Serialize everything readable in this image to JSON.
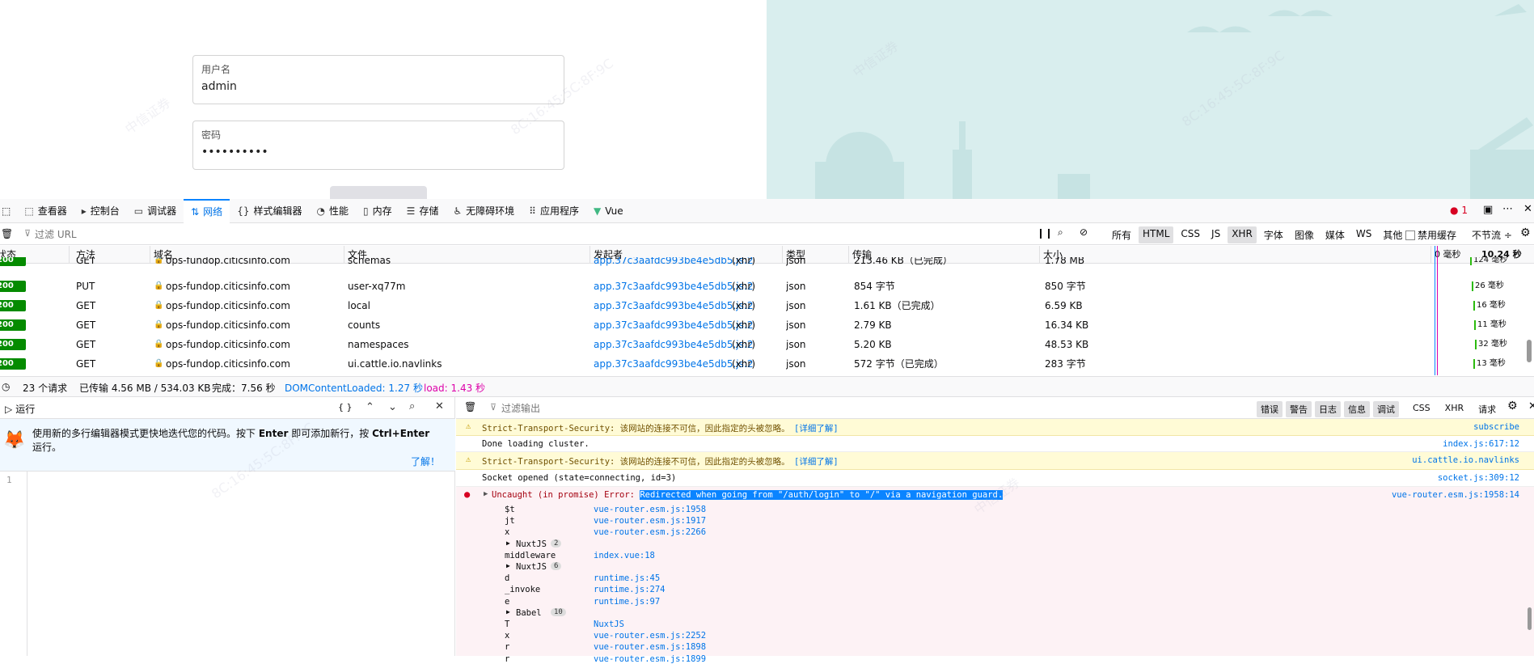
{
  "login": {
    "username_label": "用户名",
    "username_value": "admin",
    "password_label": "密码",
    "password_value": "••••••••••"
  },
  "devtools": {
    "tabs": [
      {
        "icon": "inspector-icon",
        "glyph": "⬚",
        "label": "查看器"
      },
      {
        "icon": "console-icon",
        "glyph": "▸",
        "label": "控制台"
      },
      {
        "icon": "debugger-icon",
        "glyph": "▭",
        "label": "调试器"
      },
      {
        "icon": "network-icon",
        "glyph": "⇅",
        "label": "网络"
      },
      {
        "icon": "style-editor-icon",
        "glyph": "{}",
        "label": "样式编辑器"
      },
      {
        "icon": "performance-icon",
        "glyph": "◔",
        "label": "性能"
      },
      {
        "icon": "memory-icon",
        "glyph": "▯",
        "label": "内存"
      },
      {
        "icon": "storage-icon",
        "glyph": "☰",
        "label": "存储"
      },
      {
        "icon": "accessibility-icon",
        "glyph": "♿",
        "label": "无障碍环境"
      },
      {
        "icon": "application-icon",
        "glyph": "⠿",
        "label": "应用程序"
      },
      {
        "icon": "vue-icon",
        "glyph": "▼",
        "label": "Vue"
      }
    ],
    "error_count": "1",
    "filter_placeholder": "过滤 URL",
    "filter_types": [
      "所有",
      "HTML",
      "CSS",
      "JS",
      "XHR",
      "字体",
      "图像",
      "媒体",
      "WS",
      "其他"
    ],
    "disable_cache_label": "禁用缓存",
    "throttle_label": "不节流 ÷",
    "columns": {
      "status": "状态",
      "method": "方法",
      "domain": "域名",
      "file": "文件",
      "initiator": "发起者",
      "type": "类型",
      "transferred": "传输",
      "size": "大小",
      "wf_zero": "0 毫秒",
      "wf_end": "10.24 秒"
    },
    "requests": [
      {
        "status": "200",
        "method": "GET",
        "domain": "ops-fundop.citicsinfo.com",
        "file": "schemas",
        "initiator": "app.37c3aafdc993be4e5db5.js:2",
        "initiator_type": "(xhr)",
        "type": "json",
        "transferred": "213.46 KB（已完成）",
        "size": "1.78 MB",
        "time": "124 毫秒"
      },
      {
        "status": "200",
        "method": "PUT",
        "domain": "ops-fundop.citicsinfo.com",
        "file": "user-xq77m",
        "initiator": "app.37c3aafdc993be4e5db5.js:2",
        "initiator_type": "(xhr)",
        "type": "json",
        "transferred": "854 字节",
        "size": "850 字节",
        "time": "26 毫秒"
      },
      {
        "status": "200",
        "method": "GET",
        "domain": "ops-fundop.citicsinfo.com",
        "file": "local",
        "initiator": "app.37c3aafdc993be4e5db5.js:2",
        "initiator_type": "(xhr)",
        "type": "json",
        "transferred": "1.61 KB（已完成）",
        "size": "6.59 KB",
        "time": "16 毫秒"
      },
      {
        "status": "200",
        "method": "GET",
        "domain": "ops-fundop.citicsinfo.com",
        "file": "counts",
        "initiator": "app.37c3aafdc993be4e5db5.js:2",
        "initiator_type": "(xhr)",
        "type": "json",
        "transferred": "2.79 KB",
        "size": "16.34 KB",
        "time": "11 毫秒"
      },
      {
        "status": "200",
        "method": "GET",
        "domain": "ops-fundop.citicsinfo.com",
        "file": "namespaces",
        "initiator": "app.37c3aafdc993be4e5db5.js:2",
        "initiator_type": "(xhr)",
        "type": "json",
        "transferred": "5.20 KB",
        "size": "48.53 KB",
        "time": "32 毫秒"
      },
      {
        "status": "200",
        "method": "GET",
        "domain": "ops-fundop.citicsinfo.com",
        "file": "ui.cattle.io.navlinks",
        "initiator": "app.37c3aafdc993be4e5db5.js:2",
        "initiator_type": "(xhr)",
        "type": "json",
        "transferred": "572 字节（已完成）",
        "size": "283 字节",
        "time": "13 毫秒"
      }
    ],
    "summary": {
      "requests": "23 个请求",
      "transferred": "已传输 4.56 MB / 534.03 KB",
      "finish": "完成：7.56 秒",
      "domcontentloaded": "DOMContentLoaded: 1.27 秒",
      "load": "load: 1.43 秒"
    }
  },
  "editor": {
    "run_label": "运行",
    "braces": "{ }",
    "notice_text_1": "使用新的多行编辑器模式更快地迭代您的代码。按下",
    "notice_key_1": "Enter",
    "notice_text_2": "即可添加新行，按",
    "notice_key_2": "Ctrl+Enter",
    "notice_text_3": "运行。",
    "learn_more": "了解！",
    "line_number": "1"
  },
  "console": {
    "filter_placeholder": "过滤输出",
    "levels": [
      "错误",
      "警告",
      "日志",
      "信息",
      "调试"
    ],
    "extra": [
      "CSS",
      "XHR",
      "请求"
    ],
    "messages": [
      {
        "kind": "warn",
        "text": "Strict-Transport-Security: 该网站的连接不可信，因此指定的头被忽略。",
        "link": "[详细了解]",
        "source": "subscribe"
      },
      {
        "kind": "log",
        "text": "Done loading cluster.",
        "source": "index.js:617:12"
      },
      {
        "kind": "warn",
        "text": "Strict-Transport-Security: 该网站的连接不可信，因此指定的头被忽略。",
        "link": "[详细了解]",
        "source": "ui.cattle.io.navlinks"
      },
      {
        "kind": "log",
        "text": "Socket opened (state=connecting, id=3)",
        "source": "socket.js:309:12"
      }
    ],
    "error": {
      "prefix": "Uncaught (in promise) Error:",
      "highlight": "Redirected when going from \"/auth/login\" to \"/\" via a navigation guard.",
      "source": "vue-router.esm.js:1958:14"
    },
    "stack": [
      {
        "fn": "$t",
        "loc": "vue-router.esm.js:1958"
      },
      {
        "fn": "jt",
        "loc": "vue-router.esm.js:1917"
      },
      {
        "fn": "x",
        "loc": "vue-router.esm.js:2266"
      },
      {
        "fn": "NuxtJS",
        "loc": "",
        "group": true,
        "count": "2"
      },
      {
        "fn": "middleware",
        "loc": "index.vue:18"
      },
      {
        "fn": "NuxtJS",
        "loc": "",
        "group": true,
        "count": "6"
      },
      {
        "fn": "d",
        "loc": "runtime.js:45"
      },
      {
        "fn": "_invoke",
        "loc": "runtime.js:274"
      },
      {
        "fn": "e",
        "loc": "runtime.js:97"
      },
      {
        "fn": "Babel",
        "loc": "",
        "group": true,
        "count": "10"
      },
      {
        "fn": "T",
        "loc": "NuxtJS"
      },
      {
        "fn": "x",
        "loc": "vue-router.esm.js:2252"
      },
      {
        "fn": "r",
        "loc": "vue-router.esm.js:1898"
      },
      {
        "fn": "r",
        "loc": "vue-router.esm.js:1899"
      }
    ]
  },
  "colors": {
    "accent": "#0074e8",
    "status_ok": "#058b00",
    "warn_bg": "#fffbd6",
    "err_bg": "#fdf2f5",
    "illus_bg": "#d9eeee"
  }
}
